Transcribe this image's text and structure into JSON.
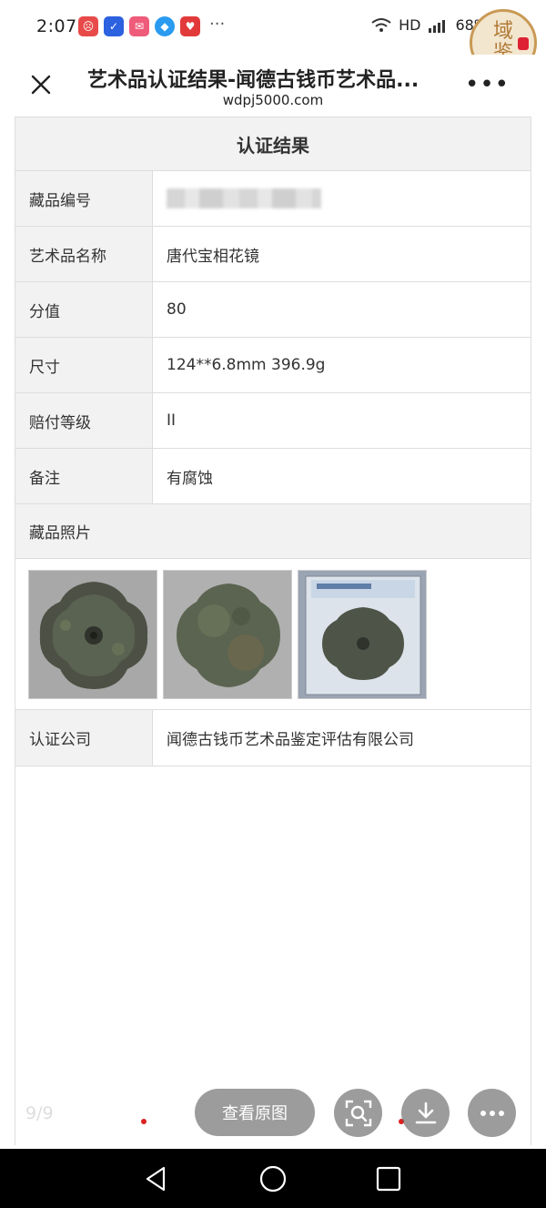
{
  "status_bar": {
    "time": "2:07",
    "network": "HD",
    "battery": "68%"
  },
  "seal": {
    "chars": "域鉴"
  },
  "header": {
    "title": "艺术品认证结果-闻德古钱币艺术品...",
    "url": "wdpj5000.com"
  },
  "page": {
    "section_title": "认证结果",
    "rows": [
      {
        "label": "藏品编号",
        "value": ""
      },
      {
        "label": "艺术品名称",
        "value": "唐代宝相花镜"
      },
      {
        "label": "分值",
        "value": "80"
      },
      {
        "label": "尺寸",
        "value": "124**6.8mm 396.9g"
      },
      {
        "label": "赔付等级",
        "value": "II"
      },
      {
        "label": "备注",
        "value": "有腐蚀"
      }
    ],
    "photos_title": "藏品照片",
    "company_label": "认证公司",
    "company_value": "闻德古钱币艺术品鉴定评估有限公司"
  },
  "viewer": {
    "page_indicator": "9/9",
    "view_original": "查看原图"
  },
  "icons": [
    "close-icon",
    "more-icon",
    "scan-search-icon",
    "download-icon",
    "more-horizontal-icon",
    "back-icon",
    "home-icon",
    "recents-icon",
    "wifi-icon",
    "signal-icon",
    "battery-icon"
  ]
}
